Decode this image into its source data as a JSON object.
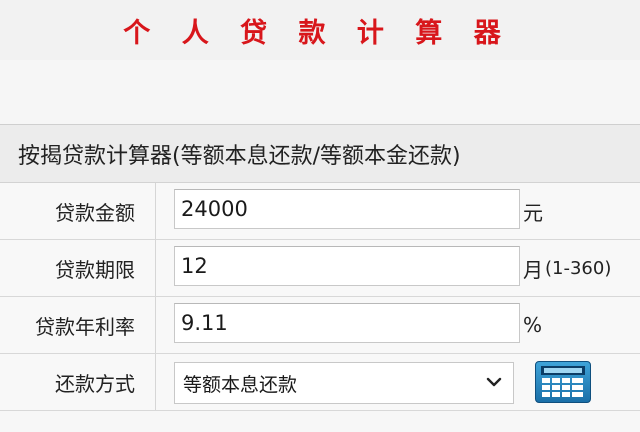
{
  "header": {
    "title": "个 人 贷 款 计 算 器"
  },
  "panel": {
    "heading": "按揭贷款计算器(等额本息还款/等额本金还款)",
    "fields": {
      "amount": {
        "label": "贷款金额",
        "value": "24000",
        "unit": "元"
      },
      "term": {
        "label": "贷款期限",
        "value": "12",
        "unit": "月",
        "hint": "(1-360)"
      },
      "rate": {
        "label": "贷款年利率",
        "value": "9.11",
        "unit": "%"
      },
      "method": {
        "label": "还款方式",
        "selected": "等额本息还款"
      }
    }
  },
  "icons": {
    "calculate": "calculator-icon",
    "dropdown": "chevron-down-icon"
  },
  "colors": {
    "title": "#d8161b",
    "button": "#2a8ac4"
  }
}
